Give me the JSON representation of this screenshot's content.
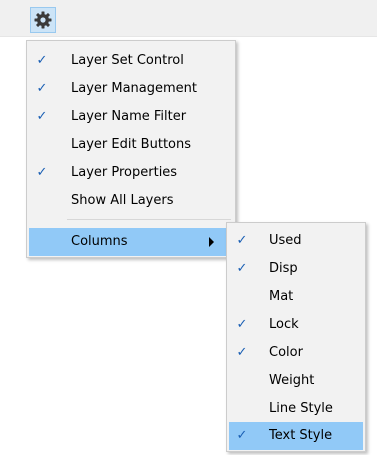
{
  "toolbar": {
    "gear_icon": "gear-icon"
  },
  "main_menu": {
    "items": [
      {
        "label": "Layer Set Control",
        "checked": true
      },
      {
        "label": "Layer Management",
        "checked": true
      },
      {
        "label": "Layer Name Filter",
        "checked": true
      },
      {
        "label": "Layer Edit Buttons",
        "checked": false
      },
      {
        "label": "Layer Properties",
        "checked": true
      },
      {
        "label": "Show All Layers",
        "checked": false
      }
    ],
    "columns_label": "Columns"
  },
  "submenu": {
    "items": [
      {
        "label": "Used",
        "checked": true
      },
      {
        "label": "Disp",
        "checked": true
      },
      {
        "label": "Mat",
        "checked": false
      },
      {
        "label": "Lock",
        "checked": true
      },
      {
        "label": "Color",
        "checked": true
      },
      {
        "label": "Weight",
        "checked": false
      },
      {
        "label": "Line Style",
        "checked": false
      },
      {
        "label": "Text Style",
        "checked": true
      }
    ]
  },
  "colors": {
    "highlight": "#91c9f7",
    "check": "#1a5fb4"
  }
}
